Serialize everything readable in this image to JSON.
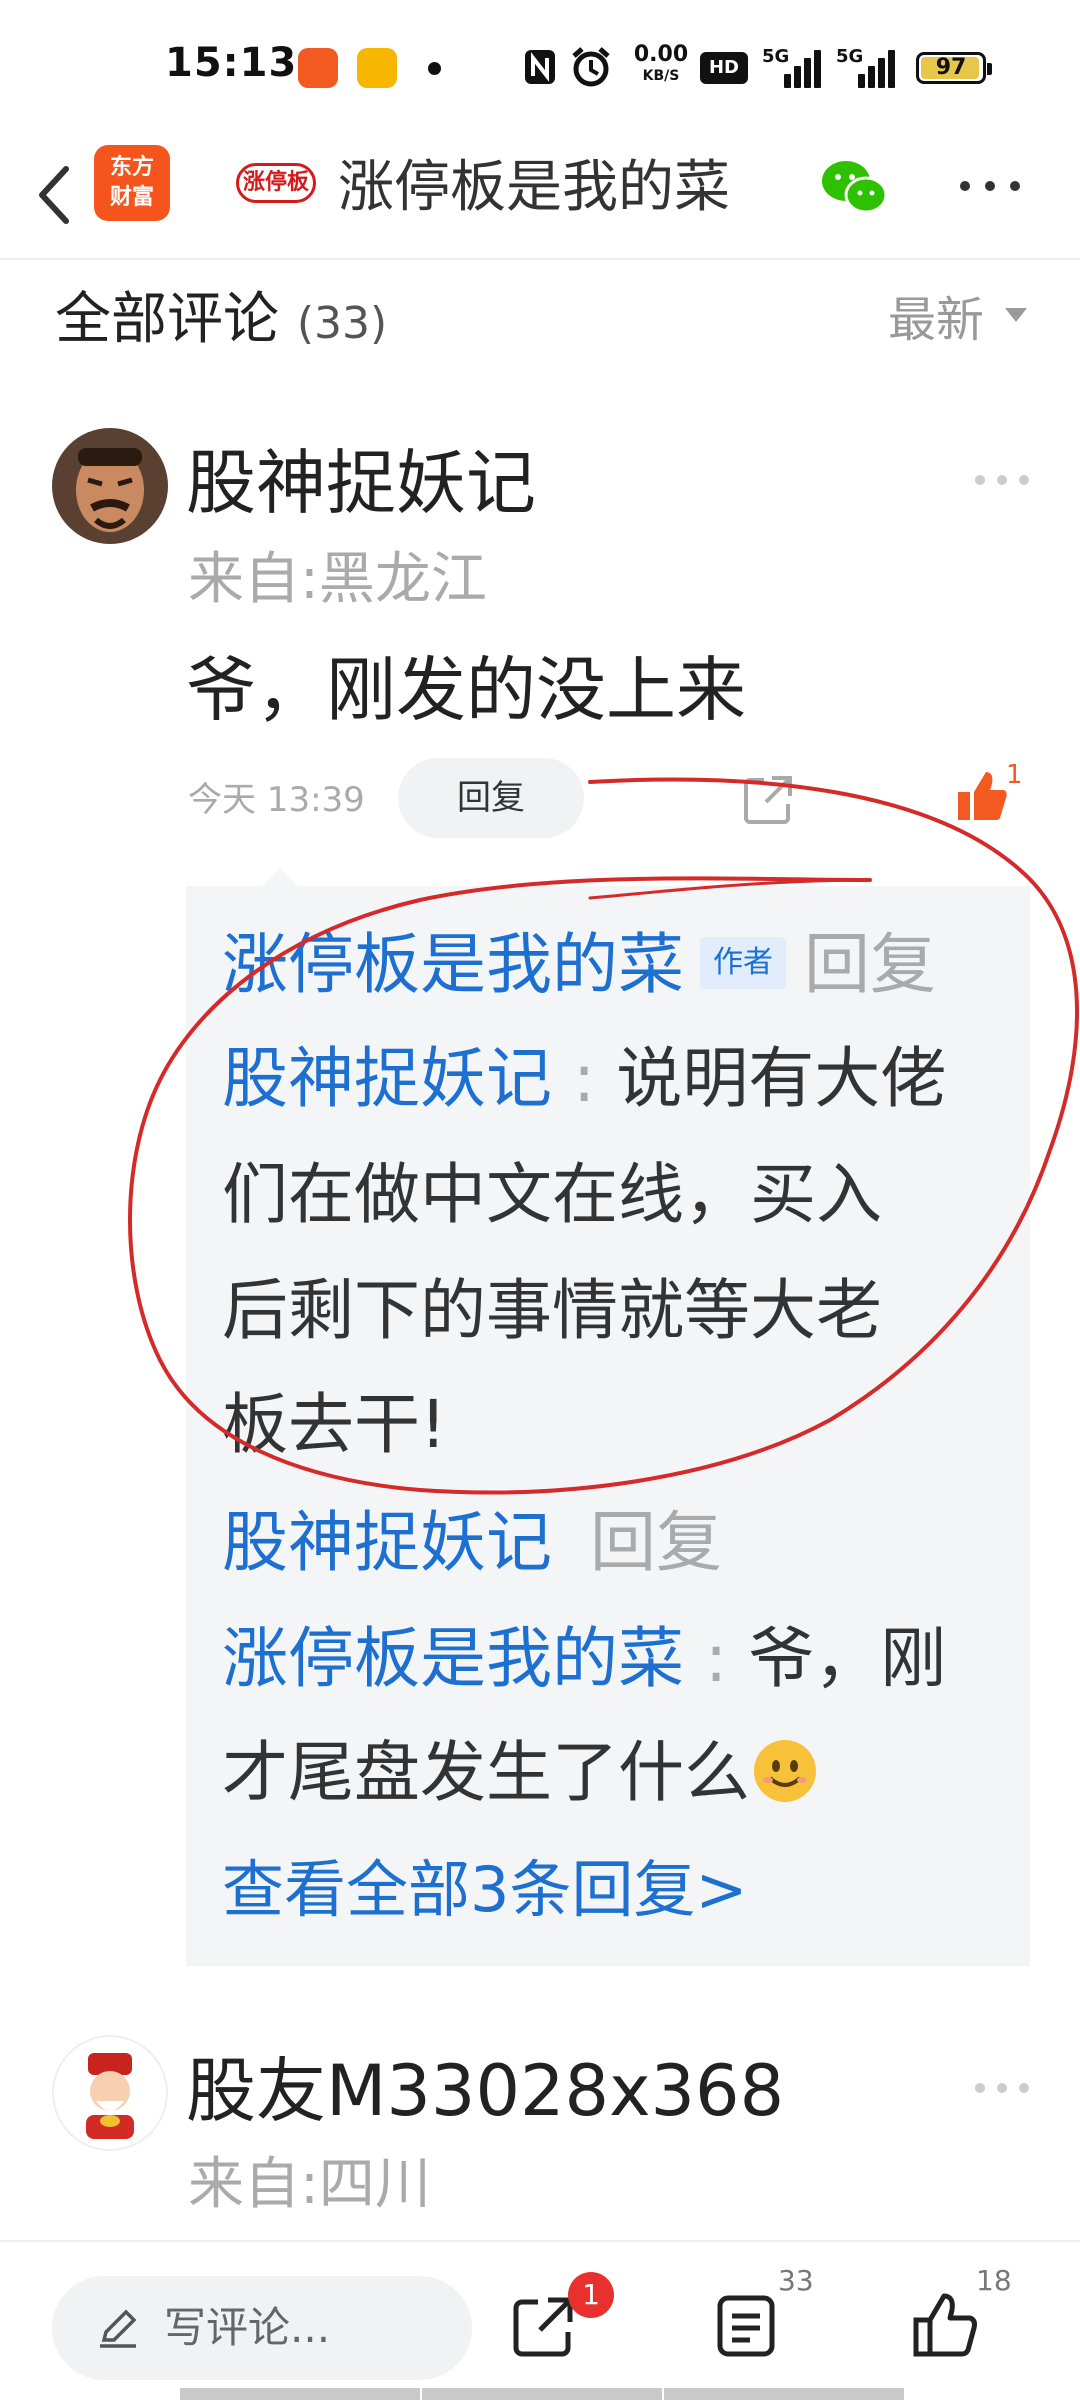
{
  "status_bar": {
    "time": "15:13",
    "net_speed_value": "0.00",
    "net_speed_unit": "KB/S",
    "hd_label": "HD",
    "signal_1_label": "5G",
    "signal_2_label": "5G",
    "battery_percent": "97",
    "battery_level": 0.97,
    "icons": [
      "app-notification-icon",
      "app-notification-icon",
      "nfc-icon",
      "alarm-icon",
      "signal-icon",
      "battery-icon"
    ]
  },
  "header": {
    "app_logo_text_line1": "东方",
    "app_logo_text_line2": "财富",
    "avatar_stamp_text": "涨停板",
    "title": "涨停板是我的菜"
  },
  "comments_section": {
    "title": "全部评论",
    "count": "(33)",
    "sort_label": "最新"
  },
  "comment1": {
    "author": "股神捉妖记",
    "location": "来自:黑龙江",
    "text": "爷，刚发的没上来",
    "time": "今天 13:39",
    "reply_label": "回复",
    "like_count": "1",
    "replies": {
      "r1_author": "涨停板是我的菜",
      "r1_tag": "作者",
      "r1_action": "回复",
      "r1_target": "股神捉妖记",
      "r1_sep": " : ",
      "r1_text_line1": "说明有大佬",
      "r1_text_line2": "们在做中文在线，买入",
      "r1_text_line3": "后剩下的事情就等大老",
      "r1_text_line4": "板去干!",
      "r2_author": "股神捉妖记",
      "r2_action": "回复",
      "r2_target": "涨停板是我的菜",
      "r2_sep": " : ",
      "r2_text_line1": "爷，刚",
      "r2_text_line2": "才尾盘发生了什么",
      "see_all": "查看全部3条回复>"
    }
  },
  "comment2": {
    "author": "股友M33028x368",
    "location": "来自:四川"
  },
  "bottom_bar": {
    "write_placeholder": "写评论...",
    "share_badge": "1",
    "comment_count": "33",
    "like_count": "18"
  },
  "colors": {
    "link_blue": "#1d6fd0",
    "brand_orange": "#f25a22",
    "annotation_red": "#d42a2a"
  }
}
